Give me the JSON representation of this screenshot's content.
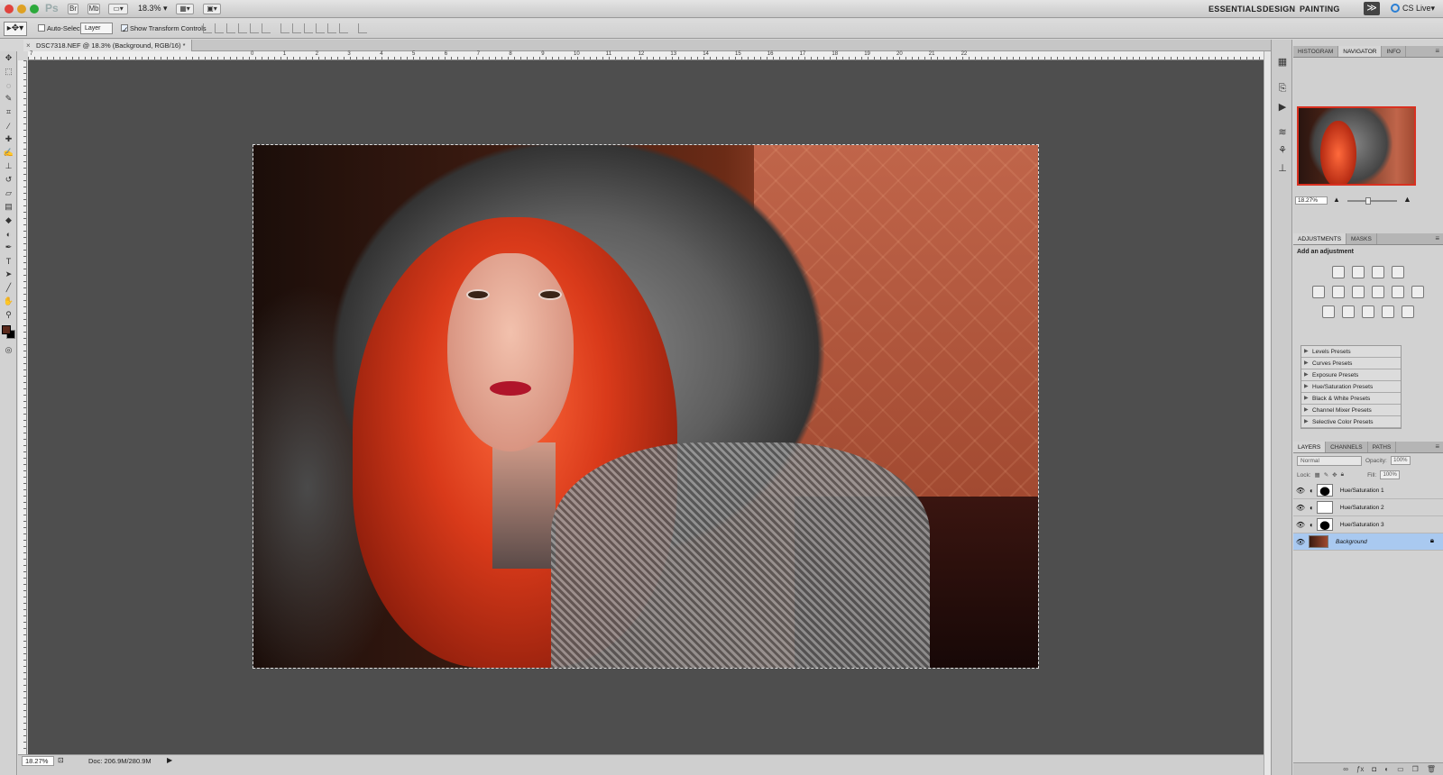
{
  "app": {
    "logo": "Ps",
    "bridge_label": "Br",
    "minibridge_label": "Mb",
    "zoom": "18.3%",
    "workspaces": [
      "ESSENTIALS",
      "DESIGN",
      "PAINTING"
    ],
    "more_label": "≫",
    "cs_live": "CS Live"
  },
  "options": {
    "auto_select_label": "Auto-Select:",
    "auto_select_target": "Layer",
    "show_transform_label": "Show Transform Controls"
  },
  "document": {
    "tab_title": "DSC7318.NEF @ 18.3% (Background, RGB/16) *"
  },
  "rulers": {
    "top_ticks": [
      "7",
      "0",
      "1",
      "2",
      "3",
      "4",
      "5",
      "6",
      "7",
      "8",
      "9",
      "10",
      "11",
      "12",
      "13",
      "14",
      "15",
      "16",
      "17",
      "18",
      "19",
      "20",
      "21",
      "22"
    ]
  },
  "status": {
    "zoom": "18.27%",
    "doc": "Doc: 206.9M/280.9M"
  },
  "navigator": {
    "tabs": [
      "HISTOGRAM",
      "NAVIGATOR",
      "INFO"
    ],
    "zoom": "18.27%"
  },
  "adjustments": {
    "tabs": [
      "ADJUSTMENTS",
      "MASKS"
    ],
    "title": "Add an adjustment",
    "presets": [
      "Levels Presets",
      "Curves Presets",
      "Exposure Presets",
      "Hue/Saturation Presets",
      "Black & White Presets",
      "Channel Mixer Presets",
      "Selective Color Presets"
    ]
  },
  "layers": {
    "tabs": [
      "LAYERS",
      "CHANNELS",
      "PATHS"
    ],
    "blend_mode": "Normal",
    "opacity_label": "Opacity:",
    "opacity": "100%",
    "lock_label": "Lock:",
    "fill_label": "Fill:",
    "fill": "100%",
    "items": [
      {
        "name": "Hue/Saturation 1"
      },
      {
        "name": "Hue/Saturation 2"
      },
      {
        "name": "Hue/Saturation 3"
      },
      {
        "name": "Background"
      }
    ]
  },
  "colors": {
    "foreground": "#5b2a1c",
    "background": "#000000",
    "selected_layer": "#a9c9f0"
  }
}
